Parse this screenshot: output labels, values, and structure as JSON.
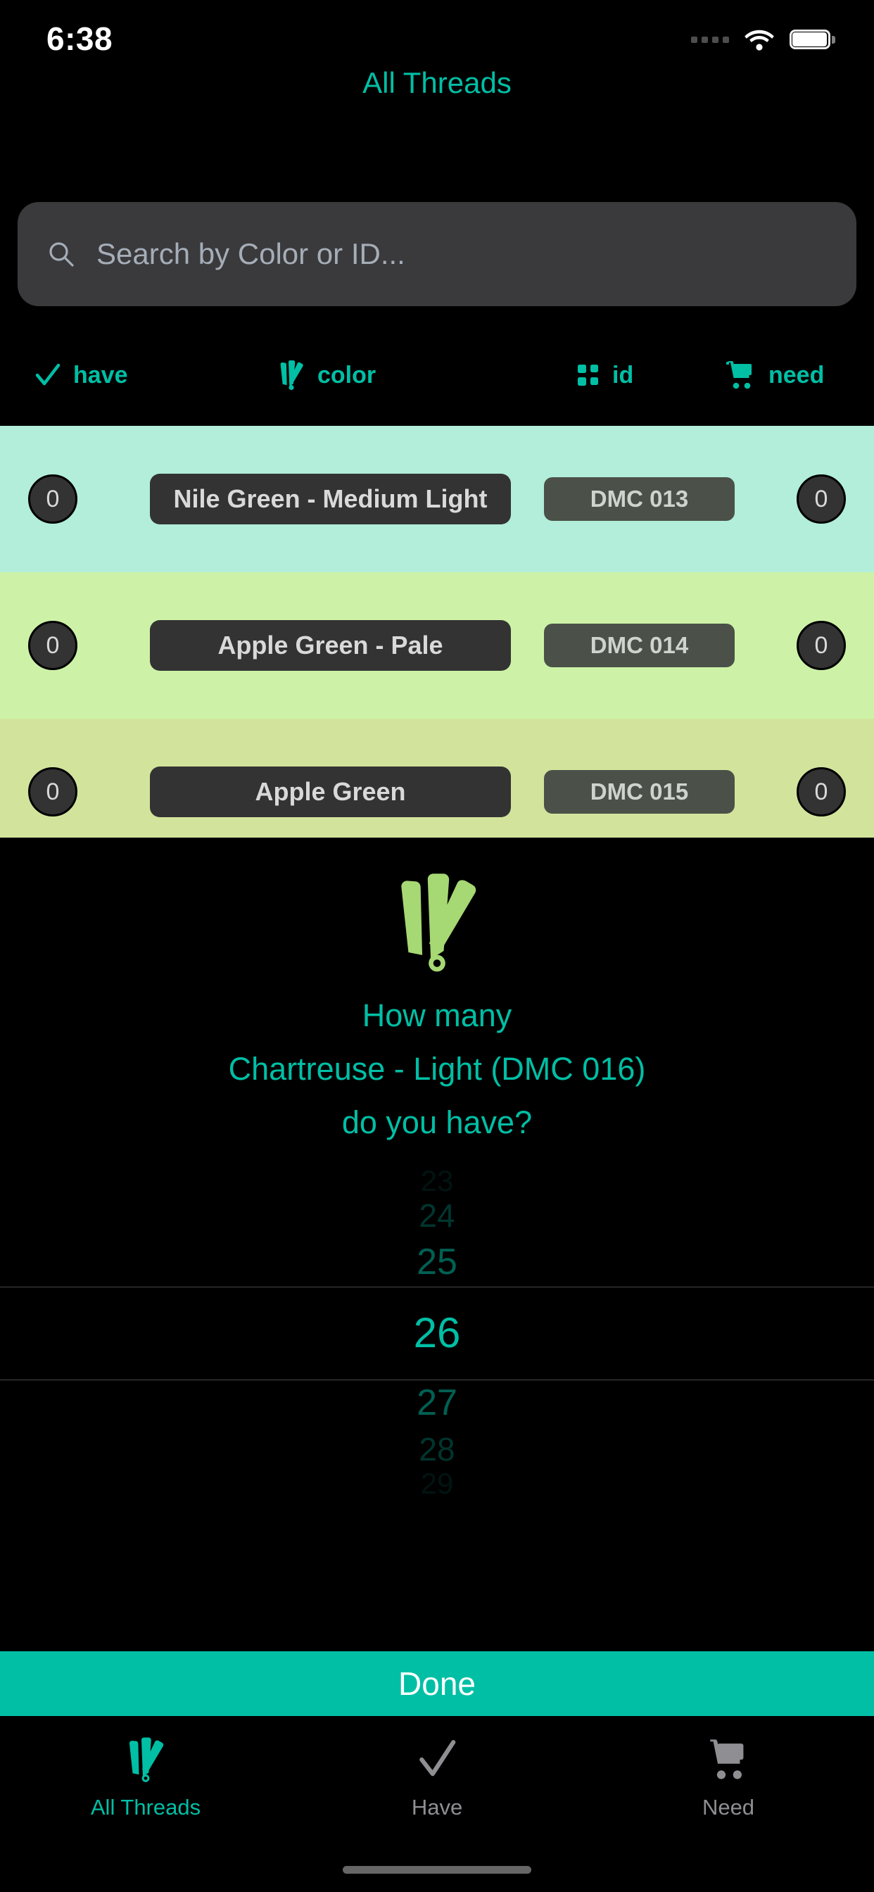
{
  "status_bar": {
    "time": "6:38",
    "cellular_icon": "cellular-dots-icon",
    "wifi_icon": "wifi-icon",
    "battery_icon": "battery-full-icon"
  },
  "header": {
    "title": "All Threads"
  },
  "search": {
    "placeholder": "Search by Color or ID...",
    "value": "",
    "icon": "search-icon"
  },
  "filters": [
    {
      "label": "have",
      "icon": "checkmark-icon"
    },
    {
      "label": "color",
      "icon": "thread-fan-icon"
    },
    {
      "label": "id",
      "icon": "grid-squares-icon"
    },
    {
      "label": "need",
      "icon": "shopping-cart-icon"
    }
  ],
  "threads": [
    {
      "have_count": "0",
      "name": "Nile Green - Medium Light",
      "id": "DMC 013",
      "need_count": "0",
      "swatch_color": "#b2eeda"
    },
    {
      "have_count": "0",
      "name": "Apple Green - Pale",
      "id": "DMC 014",
      "need_count": "0",
      "swatch_color": "#cdf2a7"
    },
    {
      "have_count": "0",
      "name": "Apple Green",
      "id": "DMC 015",
      "need_count": "0",
      "swatch_color": "#d2e49c"
    }
  ],
  "picker": {
    "logo_icon": "thread-fan-icon",
    "prompt_line1": "How many",
    "prompt_line2": "Chartreuse - Light (DMC 016)",
    "prompt_line3": "do you have?",
    "options": [
      "23",
      "24",
      "25",
      "26",
      "27",
      "28",
      "29"
    ],
    "selected": "26",
    "selected_index": 3,
    "done_label": "Done"
  },
  "tabbar": [
    {
      "label": "All Threads",
      "icon": "thread-fan-icon",
      "active": true
    },
    {
      "label": "Have",
      "icon": "checkmark-icon",
      "active": false
    },
    {
      "label": "Need",
      "icon": "shopping-cart-icon",
      "active": false
    }
  ],
  "colors": {
    "accent": "#00bfa5",
    "background": "#000000",
    "chip": "#333333",
    "id_chip": "#4b5148",
    "search_bg": "#3a3a3c",
    "inactive": "#8e8e93"
  }
}
